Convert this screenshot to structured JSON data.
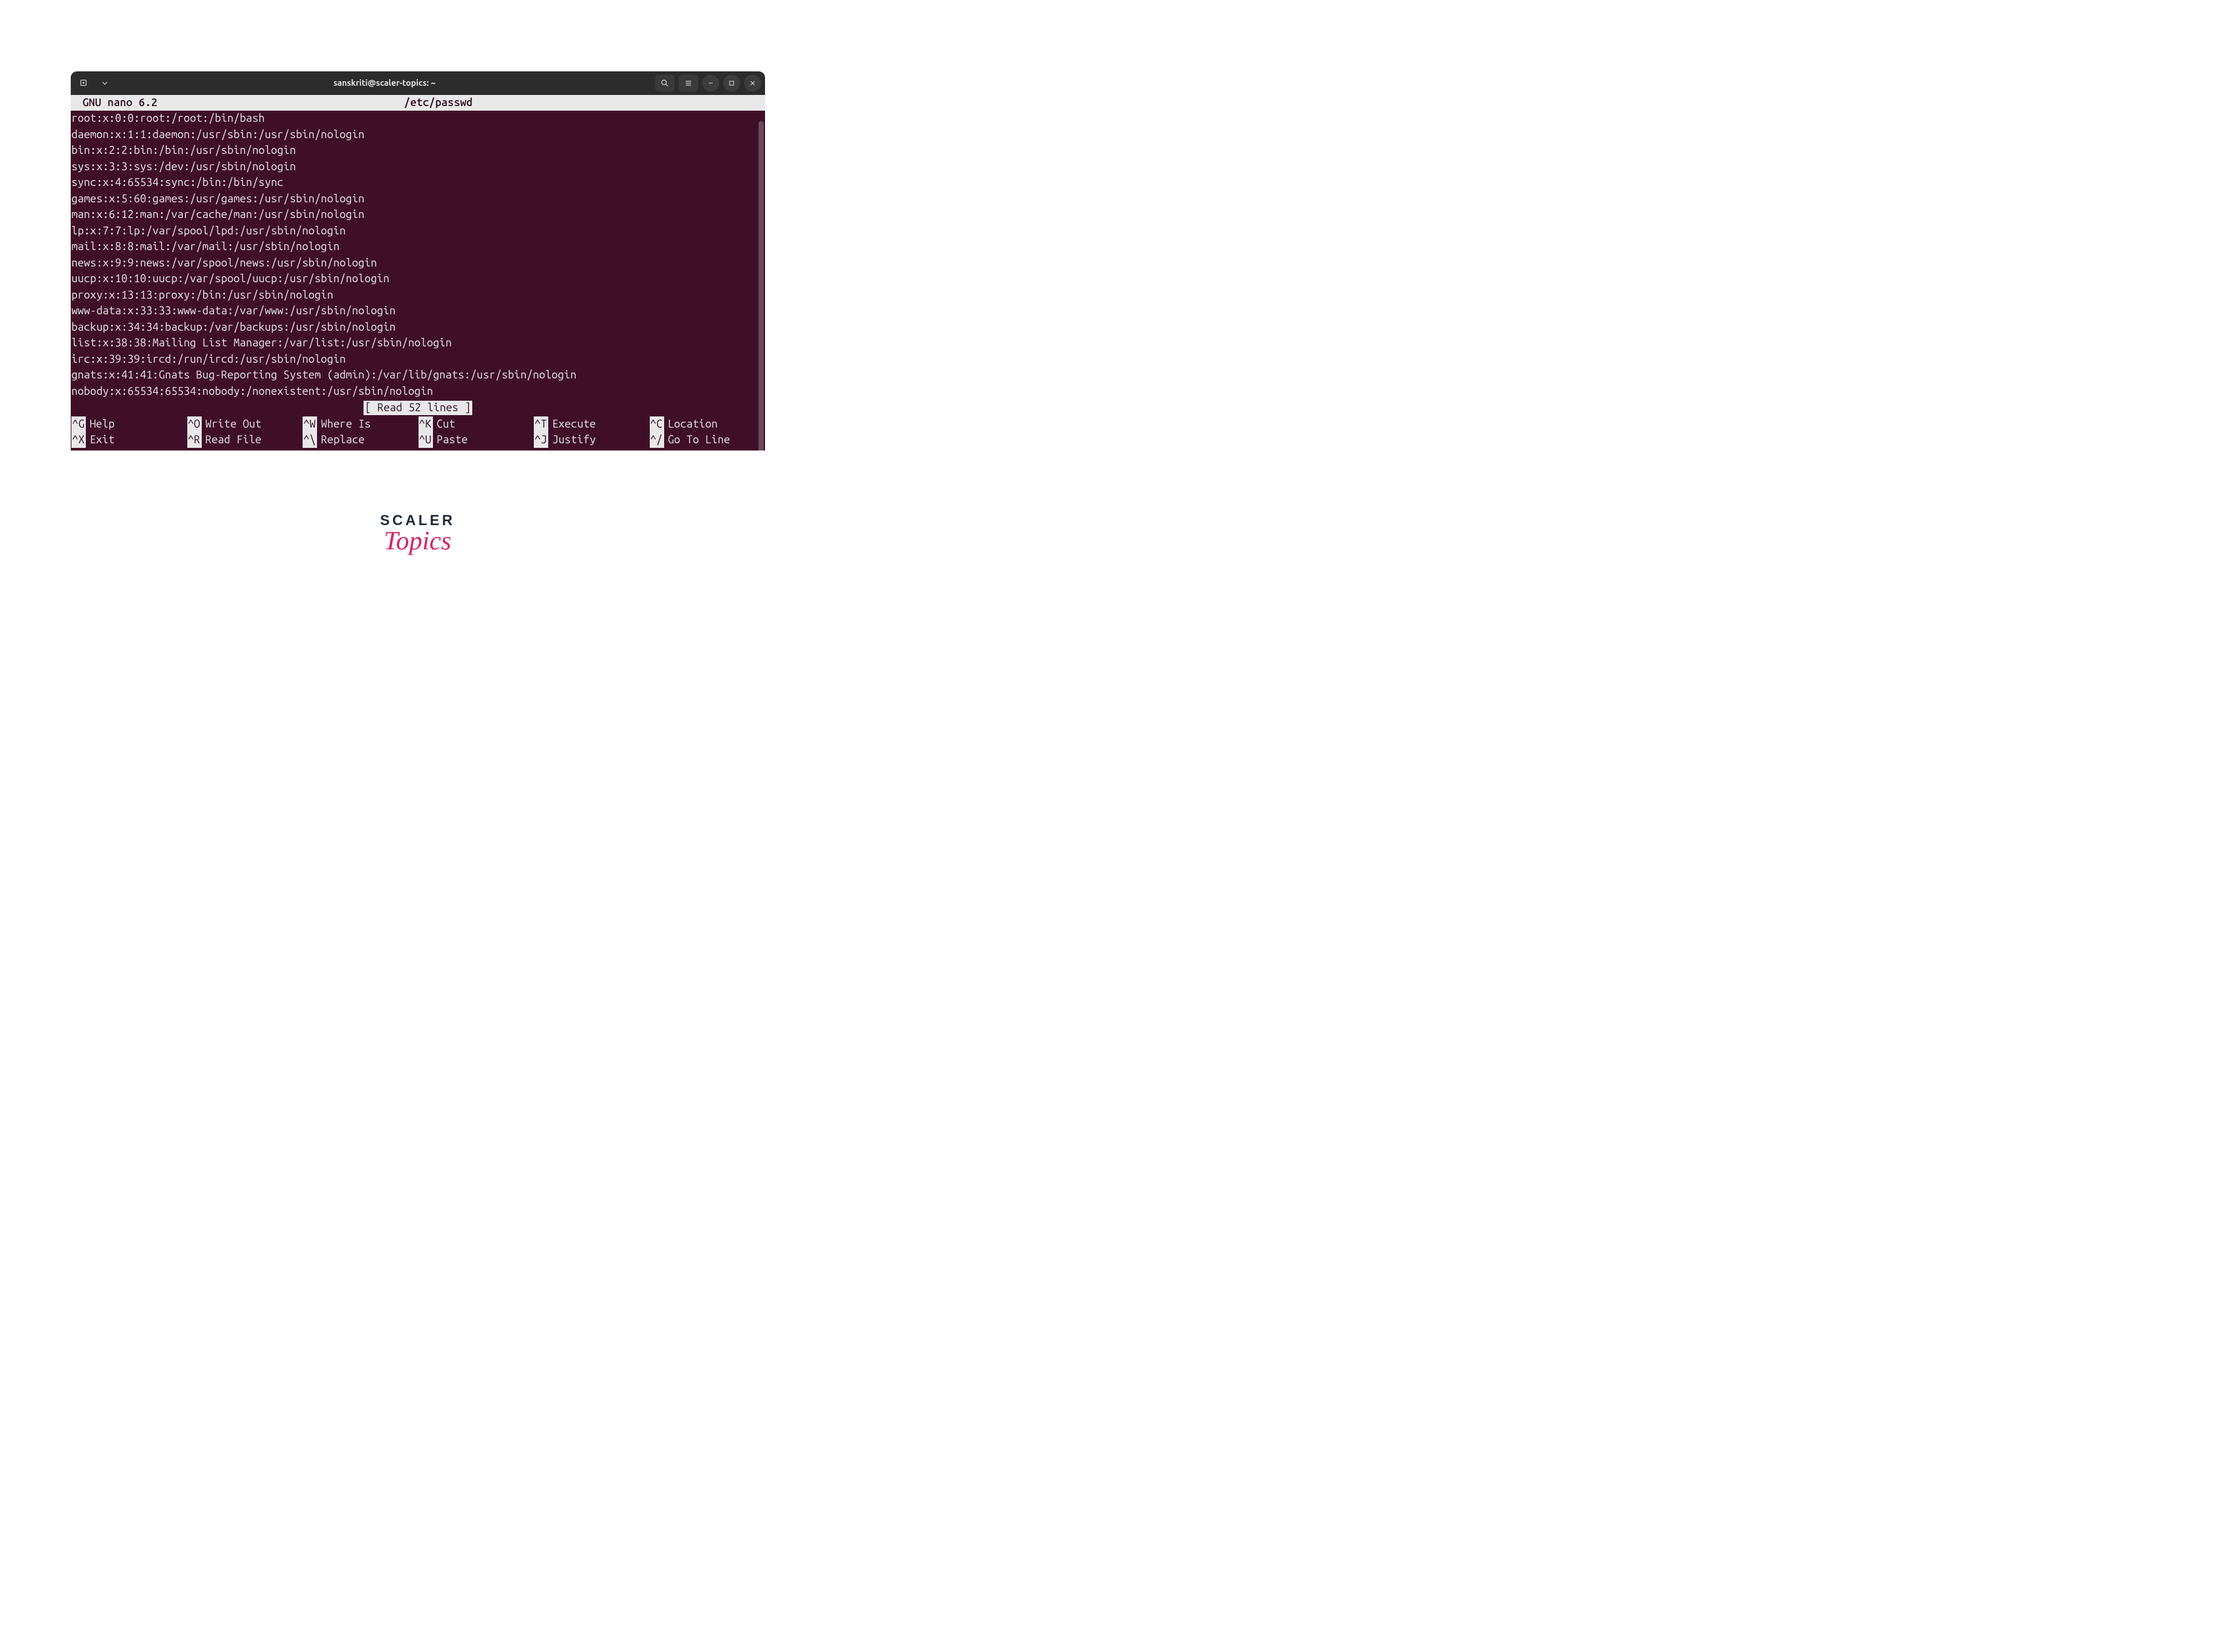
{
  "titlebar": {
    "title": "sanskriti@scaler-topics: ~"
  },
  "nano": {
    "app_label": "GNU nano 6.2",
    "filename": "/etc/passwd",
    "status": "[ Read 52 lines ]",
    "lines": [
      "root:x:0:0:root:/root:/bin/bash",
      "daemon:x:1:1:daemon:/usr/sbin:/usr/sbin/nologin",
      "bin:x:2:2:bin:/bin:/usr/sbin/nologin",
      "sys:x:3:3:sys:/dev:/usr/sbin/nologin",
      "sync:x:4:65534:sync:/bin:/bin/sync",
      "games:x:5:60:games:/usr/games:/usr/sbin/nologin",
      "man:x:6:12:man:/var/cache/man:/usr/sbin/nologin",
      "lp:x:7:7:lp:/var/spool/lpd:/usr/sbin/nologin",
      "mail:x:8:8:mail:/var/mail:/usr/sbin/nologin",
      "news:x:9:9:news:/var/spool/news:/usr/sbin/nologin",
      "uucp:x:10:10:uucp:/var/spool/uucp:/usr/sbin/nologin",
      "proxy:x:13:13:proxy:/bin:/usr/sbin/nologin",
      "www-data:x:33:33:www-data:/var/www:/usr/sbin/nologin",
      "backup:x:34:34:backup:/var/backups:/usr/sbin/nologin",
      "list:x:38:38:Mailing List Manager:/var/list:/usr/sbin/nologin",
      "irc:x:39:39:ircd:/run/ircd:/usr/sbin/nologin",
      "gnats:x:41:41:Gnats Bug-Reporting System (admin):/var/lib/gnats:/usr/sbin/nologin",
      "nobody:x:65534:65534:nobody:/nonexistent:/usr/sbin/nologin"
    ],
    "shortcuts": [
      {
        "key": "^G",
        "label": "Help"
      },
      {
        "key": "^O",
        "label": "Write Out"
      },
      {
        "key": "^W",
        "label": "Where Is"
      },
      {
        "key": "^K",
        "label": "Cut"
      },
      {
        "key": "^T",
        "label": "Execute"
      },
      {
        "key": "^C",
        "label": "Location"
      },
      {
        "key": "^X",
        "label": "Exit"
      },
      {
        "key": "^R",
        "label": "Read File"
      },
      {
        "key": "^\\",
        "label": "Replace"
      },
      {
        "key": "^U",
        "label": "Paste"
      },
      {
        "key": "^J",
        "label": "Justify"
      },
      {
        "key": "^/",
        "label": "Go To Line"
      }
    ]
  },
  "branding": {
    "line1": "SCALER",
    "line2": "Topics"
  }
}
